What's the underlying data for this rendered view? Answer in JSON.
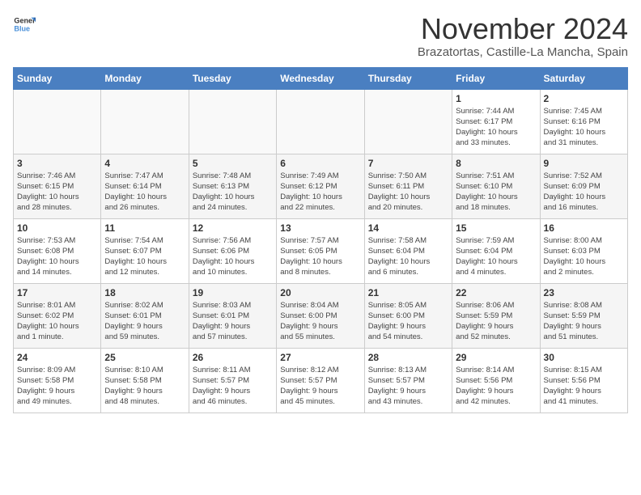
{
  "header": {
    "logo_line1": "General",
    "logo_line2": "Blue",
    "month_title": "November 2024",
    "location": "Brazatortas, Castille-La Mancha, Spain"
  },
  "weekdays": [
    "Sunday",
    "Monday",
    "Tuesday",
    "Wednesday",
    "Thursday",
    "Friday",
    "Saturday"
  ],
  "weeks": [
    [
      {
        "day": "",
        "info": ""
      },
      {
        "day": "",
        "info": ""
      },
      {
        "day": "",
        "info": ""
      },
      {
        "day": "",
        "info": ""
      },
      {
        "day": "",
        "info": ""
      },
      {
        "day": "1",
        "info": "Sunrise: 7:44 AM\nSunset: 6:17 PM\nDaylight: 10 hours\nand 33 minutes."
      },
      {
        "day": "2",
        "info": "Sunrise: 7:45 AM\nSunset: 6:16 PM\nDaylight: 10 hours\nand 31 minutes."
      }
    ],
    [
      {
        "day": "3",
        "info": "Sunrise: 7:46 AM\nSunset: 6:15 PM\nDaylight: 10 hours\nand 28 minutes."
      },
      {
        "day": "4",
        "info": "Sunrise: 7:47 AM\nSunset: 6:14 PM\nDaylight: 10 hours\nand 26 minutes."
      },
      {
        "day": "5",
        "info": "Sunrise: 7:48 AM\nSunset: 6:13 PM\nDaylight: 10 hours\nand 24 minutes."
      },
      {
        "day": "6",
        "info": "Sunrise: 7:49 AM\nSunset: 6:12 PM\nDaylight: 10 hours\nand 22 minutes."
      },
      {
        "day": "7",
        "info": "Sunrise: 7:50 AM\nSunset: 6:11 PM\nDaylight: 10 hours\nand 20 minutes."
      },
      {
        "day": "8",
        "info": "Sunrise: 7:51 AM\nSunset: 6:10 PM\nDaylight: 10 hours\nand 18 minutes."
      },
      {
        "day": "9",
        "info": "Sunrise: 7:52 AM\nSunset: 6:09 PM\nDaylight: 10 hours\nand 16 minutes."
      }
    ],
    [
      {
        "day": "10",
        "info": "Sunrise: 7:53 AM\nSunset: 6:08 PM\nDaylight: 10 hours\nand 14 minutes."
      },
      {
        "day": "11",
        "info": "Sunrise: 7:54 AM\nSunset: 6:07 PM\nDaylight: 10 hours\nand 12 minutes."
      },
      {
        "day": "12",
        "info": "Sunrise: 7:56 AM\nSunset: 6:06 PM\nDaylight: 10 hours\nand 10 minutes."
      },
      {
        "day": "13",
        "info": "Sunrise: 7:57 AM\nSunset: 6:05 PM\nDaylight: 10 hours\nand 8 minutes."
      },
      {
        "day": "14",
        "info": "Sunrise: 7:58 AM\nSunset: 6:04 PM\nDaylight: 10 hours\nand 6 minutes."
      },
      {
        "day": "15",
        "info": "Sunrise: 7:59 AM\nSunset: 6:04 PM\nDaylight: 10 hours\nand 4 minutes."
      },
      {
        "day": "16",
        "info": "Sunrise: 8:00 AM\nSunset: 6:03 PM\nDaylight: 10 hours\nand 2 minutes."
      }
    ],
    [
      {
        "day": "17",
        "info": "Sunrise: 8:01 AM\nSunset: 6:02 PM\nDaylight: 10 hours\nand 1 minute."
      },
      {
        "day": "18",
        "info": "Sunrise: 8:02 AM\nSunset: 6:01 PM\nDaylight: 9 hours\nand 59 minutes."
      },
      {
        "day": "19",
        "info": "Sunrise: 8:03 AM\nSunset: 6:01 PM\nDaylight: 9 hours\nand 57 minutes."
      },
      {
        "day": "20",
        "info": "Sunrise: 8:04 AM\nSunset: 6:00 PM\nDaylight: 9 hours\nand 55 minutes."
      },
      {
        "day": "21",
        "info": "Sunrise: 8:05 AM\nSunset: 6:00 PM\nDaylight: 9 hours\nand 54 minutes."
      },
      {
        "day": "22",
        "info": "Sunrise: 8:06 AM\nSunset: 5:59 PM\nDaylight: 9 hours\nand 52 minutes."
      },
      {
        "day": "23",
        "info": "Sunrise: 8:08 AM\nSunset: 5:59 PM\nDaylight: 9 hours\nand 51 minutes."
      }
    ],
    [
      {
        "day": "24",
        "info": "Sunrise: 8:09 AM\nSunset: 5:58 PM\nDaylight: 9 hours\nand 49 minutes."
      },
      {
        "day": "25",
        "info": "Sunrise: 8:10 AM\nSunset: 5:58 PM\nDaylight: 9 hours\nand 48 minutes."
      },
      {
        "day": "26",
        "info": "Sunrise: 8:11 AM\nSunset: 5:57 PM\nDaylight: 9 hours\nand 46 minutes."
      },
      {
        "day": "27",
        "info": "Sunrise: 8:12 AM\nSunset: 5:57 PM\nDaylight: 9 hours\nand 45 minutes."
      },
      {
        "day": "28",
        "info": "Sunrise: 8:13 AM\nSunset: 5:57 PM\nDaylight: 9 hours\nand 43 minutes."
      },
      {
        "day": "29",
        "info": "Sunrise: 8:14 AM\nSunset: 5:56 PM\nDaylight: 9 hours\nand 42 minutes."
      },
      {
        "day": "30",
        "info": "Sunrise: 8:15 AM\nSunset: 5:56 PM\nDaylight: 9 hours\nand 41 minutes."
      }
    ]
  ]
}
